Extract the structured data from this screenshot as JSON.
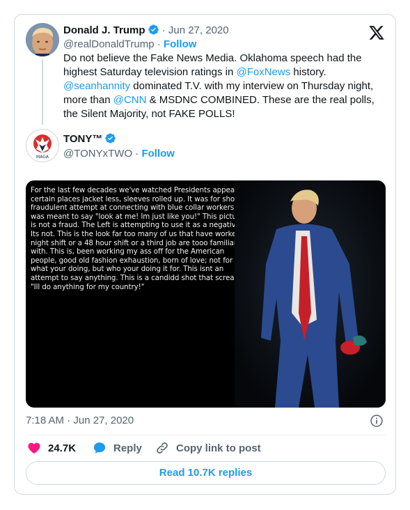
{
  "original": {
    "name": "Donald J. Trump",
    "handle": "@realDonaldTrump",
    "date": "Jun 27, 2020",
    "separator": "·",
    "follow_label": "Follow",
    "text_parts": {
      "p1": "Do not believe the Fake News Media. Oklahoma speech had the highest Saturday television ratings in ",
      "m1": "@FoxNews",
      "p2": " history. ",
      "m2": "@seanhannity",
      "p3": " dominated T.V. with my interview on Thursday night, more than ",
      "m3": "@CNN",
      "p4": " & MSDNC COMBINED. These are the real polls, the Silent Majority, not FAKE POLLS!"
    }
  },
  "reply": {
    "name": "TONY™",
    "handle": "@TONYxTWO",
    "separator": "·",
    "follow_label": "Follow",
    "avatar_label": "MAGA",
    "image_caption": "For the last few decades we've watched Presidents appear in certain places jacket less, sleeves rolled up.  It was for show.  A fraudulent attempt at connecting with blue collar workers.  It was meant to say \"look at me!  Im just like you!\" This picture is not a fraud.  The Left is attempting to use it as a negative.  Its not.  This is the look far too many of us that have worked a night shift or a 48 hour shift or a third job are tooo familiar with.  This is, been working my ass off for the American people, good old fashion exhaustion, born of love; not for what your doing, but who your doing it for.  This isnt an attempt to say anything.  This is a candidd shot that screams \"Ill do anything for my country!\"",
    "timestamp": "7:18 AM · Jun 27, 2020",
    "likes": "24.7K",
    "reply_label": "Reply",
    "copy_label": "Copy link to post",
    "read_replies_label": "Read 10.7K replies"
  },
  "colors": {
    "accent": "#1d9bf0",
    "like": "#f91880",
    "muted": "#536471",
    "text": "#0f1419",
    "border": "#cfd9de"
  },
  "icons": {
    "platform_logo": "x-logo-icon",
    "verified": "verified-badge-icon",
    "like": "heart-icon",
    "reply": "speech-bubble-icon",
    "copy": "link-icon",
    "info": "info-icon"
  }
}
